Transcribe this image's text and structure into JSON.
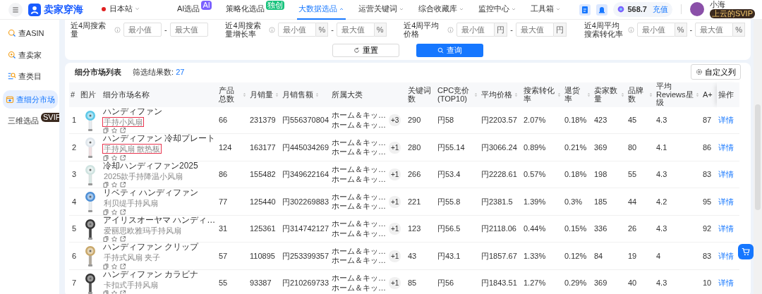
{
  "topbar": {
    "logo": "卖家穿海",
    "site": "日本站",
    "nav": [
      {
        "label": "AI选品",
        "kind": "badge",
        "badge": "AI",
        "color": "#7b61ff",
        "selected": false
      },
      {
        "label": "策略化选品",
        "kind": "badge",
        "badge": "独创",
        "color": "#19c37d",
        "selected": false
      },
      {
        "label": "大数据选品",
        "kind": "menu",
        "expanded": true,
        "selected": true
      },
      {
        "label": "运营关键词",
        "kind": "menu",
        "expanded": false,
        "selected": false
      },
      {
        "label": "综合收藏库",
        "kind": "menu",
        "expanded": false,
        "selected": false
      },
      {
        "label": "监控中心",
        "kind": "menu",
        "expanded": false,
        "selected": false
      },
      {
        "label": "工具箱",
        "kind": "menu",
        "expanded": false,
        "selected": false
      }
    ],
    "points": "568.7",
    "recharge": "充值",
    "user": "小海",
    "user_badge": "上云的SVIP"
  },
  "sidebar": {
    "items": [
      {
        "label": "查ASIN",
        "selected": false
      },
      {
        "label": "查卖家",
        "selected": false
      },
      {
        "label": "查类目",
        "selected": false
      },
      {
        "label": "查细分市场",
        "selected": true
      },
      {
        "label": "三维选品",
        "badge": "SVIP",
        "selected": false
      }
    ]
  },
  "filters": [
    {
      "label": "近4周搜索量",
      "min_placeholder": "最小值",
      "max_placeholder": "最大值",
      "separator": "-"
    },
    {
      "label": "近4周搜索量增长率",
      "min_unit": "%",
      "max_unit": "%",
      "min_placeholder": "最小值",
      "max_placeholder": "最大值",
      "separator": "-"
    },
    {
      "label": "近4周平均价格",
      "min_unit": "円",
      "max_unit": "円",
      "min_placeholder": "最小值",
      "max_placeholder": "最大值",
      "separator": "-"
    },
    {
      "label": "近4周平均搜索转化率",
      "min_unit": "%",
      "max_unit": "%",
      "min_placeholder": "最小值",
      "max_placeholder": "最大值",
      "separator": "-"
    }
  ],
  "filter_buttons": {
    "reset": "重置",
    "search": "查询"
  },
  "list": {
    "title": "细分市场列表",
    "count_label": "筛选结果数:",
    "count": "27",
    "customize": "自定义列"
  },
  "table": {
    "columns": [
      {
        "label": "#",
        "sortable": false
      },
      {
        "label": "图片",
        "sortable": false
      },
      {
        "label": "细分市场名称",
        "sortable": false
      },
      {
        "label": "产品总数",
        "sortable": true
      },
      {
        "label": "月销量",
        "sortable": true
      },
      {
        "label": "月销售额",
        "sortable": true
      },
      {
        "label": "所属大类",
        "sortable": false
      },
      {
        "label": "关键词数",
        "sortable": false
      },
      {
        "label": "CPC竞价(TOP10)",
        "sortable": true
      },
      {
        "label": "平均价格",
        "sortable": true
      },
      {
        "label": "搜索转化率",
        "sortable": true
      },
      {
        "label": "退货率",
        "sortable": true
      },
      {
        "label": "卖家数量",
        "sortable": true
      },
      {
        "label": "品牌数",
        "sortable": true
      },
      {
        "label": "平均Reviews星级",
        "sortable": true
      },
      {
        "label": "A+",
        "sortable": false
      },
      {
        "label": "操作",
        "sortable": false
      }
    ],
    "rows": [
      {
        "index": "1",
        "name": "ハンディファン",
        "subtitle": "手持小风扇",
        "highlighted": true,
        "products": "66",
        "sales": "231379",
        "revenue": "円556370804",
        "categories": [
          "ホーム＆キッ…",
          "ホーム＆キッ…"
        ],
        "more": "+3",
        "keywords": "290",
        "cpc": "円58",
        "price": "円2203.57",
        "conversion": "2.07%",
        "returns": "0.18%",
        "sellers": "423",
        "brands": "45",
        "rating": "4.3",
        "aplus": "87",
        "action": "详情"
      },
      {
        "index": "2",
        "name": "ハンディファン 冷却プレート",
        "subtitle": "手持风扇 散热板",
        "highlighted": true,
        "products": "124",
        "sales": "163177",
        "revenue": "円445034269",
        "categories": [
          "ホーム＆キッ…",
          "ホーム＆キッ…"
        ],
        "more": "+1",
        "keywords": "280",
        "cpc": "円55.14",
        "price": "円3066.24",
        "conversion": "0.89%",
        "returns": "0.21%",
        "sellers": "369",
        "brands": "80",
        "rating": "4.1",
        "aplus": "86",
        "action": "详情"
      },
      {
        "index": "3",
        "name": "冷却ハンディファン2025",
        "subtitle": "2025款手持降温小风扇",
        "highlighted": false,
        "products": "86",
        "sales": "155482",
        "revenue": "円349622164",
        "categories": [
          "ホーム＆キッ…",
          "ホーム＆キッ…"
        ],
        "more": "+1",
        "keywords": "266",
        "cpc": "円53.4",
        "price": "円2228.61",
        "conversion": "0.57%",
        "returns": "0.18%",
        "sellers": "198",
        "brands": "55",
        "rating": "4.3",
        "aplus": "83",
        "action": "详情"
      },
      {
        "index": "4",
        "name": "リベティ ハンディファン",
        "subtitle": "利贝缇手持风扇",
        "highlighted": false,
        "products": "77",
        "sales": "125440",
        "revenue": "円302269883",
        "categories": [
          "ホーム＆キッ…",
          "ホーム＆キッ…"
        ],
        "more": "+1",
        "keywords": "221",
        "cpc": "円55.8",
        "price": "円2381.5",
        "conversion": "1.39%",
        "returns": "0.3%",
        "sellers": "185",
        "brands": "44",
        "rating": "4.2",
        "aplus": "95",
        "action": "详情"
      },
      {
        "index": "5",
        "name": "アイリスオーヤマ ハンディ…",
        "subtitle": "爱丽思欧雅玛手持风扇",
        "highlighted": false,
        "products": "31",
        "sales": "125361",
        "revenue": "円314742127",
        "categories": [
          "ホーム＆キッ…",
          "ホーム＆キッ…"
        ],
        "more": "+1",
        "keywords": "123",
        "cpc": "円56.5",
        "price": "円2118.06",
        "conversion": "0.44%",
        "returns": "0.15%",
        "sellers": "336",
        "brands": "26",
        "rating": "4.3",
        "aplus": "92",
        "action": "详情"
      },
      {
        "index": "6",
        "name": "ハンディファン クリップ",
        "subtitle": "手持式风扇 夹子",
        "highlighted": false,
        "products": "57",
        "sales": "110895",
        "revenue": "円253399357",
        "categories": [
          "ホーム＆キッ…",
          "ホーム＆キッ…"
        ],
        "more": "+1",
        "keywords": "43",
        "cpc": "円43.1",
        "price": "円1857.67",
        "conversion": "1.33%",
        "returns": "0.12%",
        "sellers": "84",
        "brands": "19",
        "rating": "4",
        "aplus": "83",
        "action": "详情"
      },
      {
        "index": "7",
        "name": "ハンディファン カラビナ",
        "subtitle": "卡扣式手持风扇",
        "highlighted": false,
        "products": "55",
        "sales": "93387",
        "revenue": "円210269733",
        "categories": [
          "ホーム＆キッ…",
          "ホーム＆キッ…"
        ],
        "more": "+1",
        "keywords": "85",
        "cpc": "円56",
        "price": "円1843.51",
        "conversion": "1.27%",
        "returns": "0.29%",
        "sellers": "369",
        "brands": "40",
        "rating": "4.3",
        "aplus": "10",
        "action": "详情"
      }
    ]
  }
}
